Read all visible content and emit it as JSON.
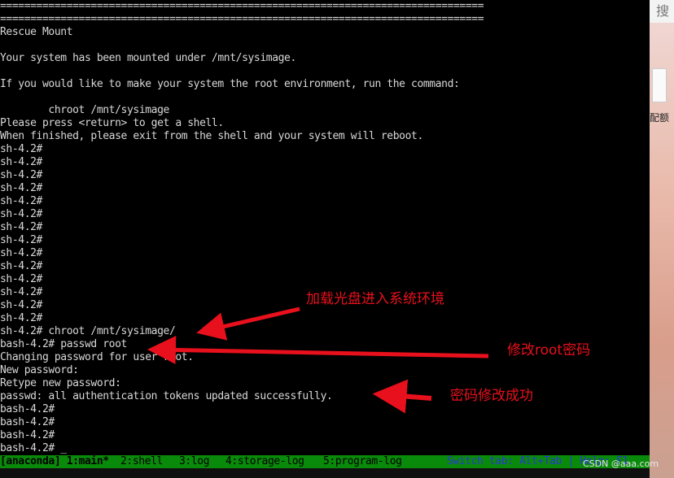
{
  "terminal": {
    "lines": [
      "================================================================================",
      "================================================================================",
      "Rescue Mount",
      "",
      "Your system has been mounted under /mnt/sysimage.",
      "",
      "If you would like to make your system the root environment, run the command:",
      "",
      "        chroot /mnt/sysimage",
      "Please press <return> to get a shell.",
      "When finished, please exit from the shell and your system will reboot.",
      "sh-4.2#",
      "sh-4.2#",
      "sh-4.2#",
      "sh-4.2#",
      "sh-4.2#",
      "sh-4.2#",
      "sh-4.2#",
      "sh-4.2#",
      "sh-4.2#",
      "sh-4.2#",
      "sh-4.2#",
      "sh-4.2#",
      "sh-4.2#",
      "sh-4.2#",
      "sh-4.2# chroot /mnt/sysimage/",
      "bash-4.2# passwd root",
      "Changing password for user root.",
      "New password:",
      "Retype new password:",
      "passwd: all authentication tokens updated successfully.",
      "bash-4.2#",
      "bash-4.2#",
      "bash-4.2#",
      "bash-4.2# _"
    ]
  },
  "statusbar": {
    "tabs": [
      {
        "label": "[anaconda] 1:main*",
        "selected": true
      },
      {
        "label": "2:shell",
        "selected": false
      },
      {
        "label": "3:log",
        "selected": false
      },
      {
        "label": "4:storage-log",
        "selected": false
      },
      {
        "label": "5:program-log",
        "selected": false
      }
    ],
    "switch_text": "Switch tab: Alt+Tab | Help: F1"
  },
  "annotations": {
    "mount_note": "加载光盘进入系统环境",
    "passwd_note": "修改root密码",
    "success_note": "密码修改成功"
  },
  "side_panel": {
    "search_glyph": "搜",
    "doc_label": "配额"
  },
  "watermark": "CSDN @aaa.com",
  "colors": {
    "terminal_bg": "#000000",
    "terminal_text": "#d8d8d8",
    "statusbar_bg": "#0a8a0a",
    "annotation_red": "#e8101c"
  }
}
